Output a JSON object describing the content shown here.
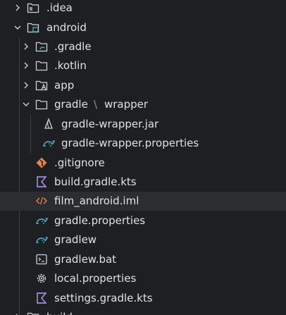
{
  "tree": {
    "idea": ".idea",
    "android": "android",
    "gradle_dir": ".gradle",
    "kotlin_dir": ".kotlin",
    "app": "app",
    "gradle_wrapper_a": "gradle",
    "gradle_wrapper_sep": "\\",
    "gradle_wrapper_b": "wrapper",
    "wrapper_jar": "gradle-wrapper.jar",
    "wrapper_props": "gradle-wrapper.properties",
    "gitignore": ".gitignore",
    "build_gradle": "build.gradle.kts",
    "film_iml": "film_android.iml",
    "gradle_props": "gradle.properties",
    "gradlew": "gradlew",
    "gradlew_bat": "gradlew.bat",
    "local_props": "local.properties",
    "settings_gradle": "settings.gradle.kts",
    "cut_off": "build"
  },
  "colors": {
    "background": "#1e1f22",
    "selected_row": "#2b2d30",
    "text": "#dfe1e5",
    "icon_gray": "#ced0d6",
    "gradle_blue": "#4eb8d8",
    "git_orange": "#e8834b",
    "kotlin_purple": "#b99bf8",
    "xml_orange": "#e8834b"
  }
}
